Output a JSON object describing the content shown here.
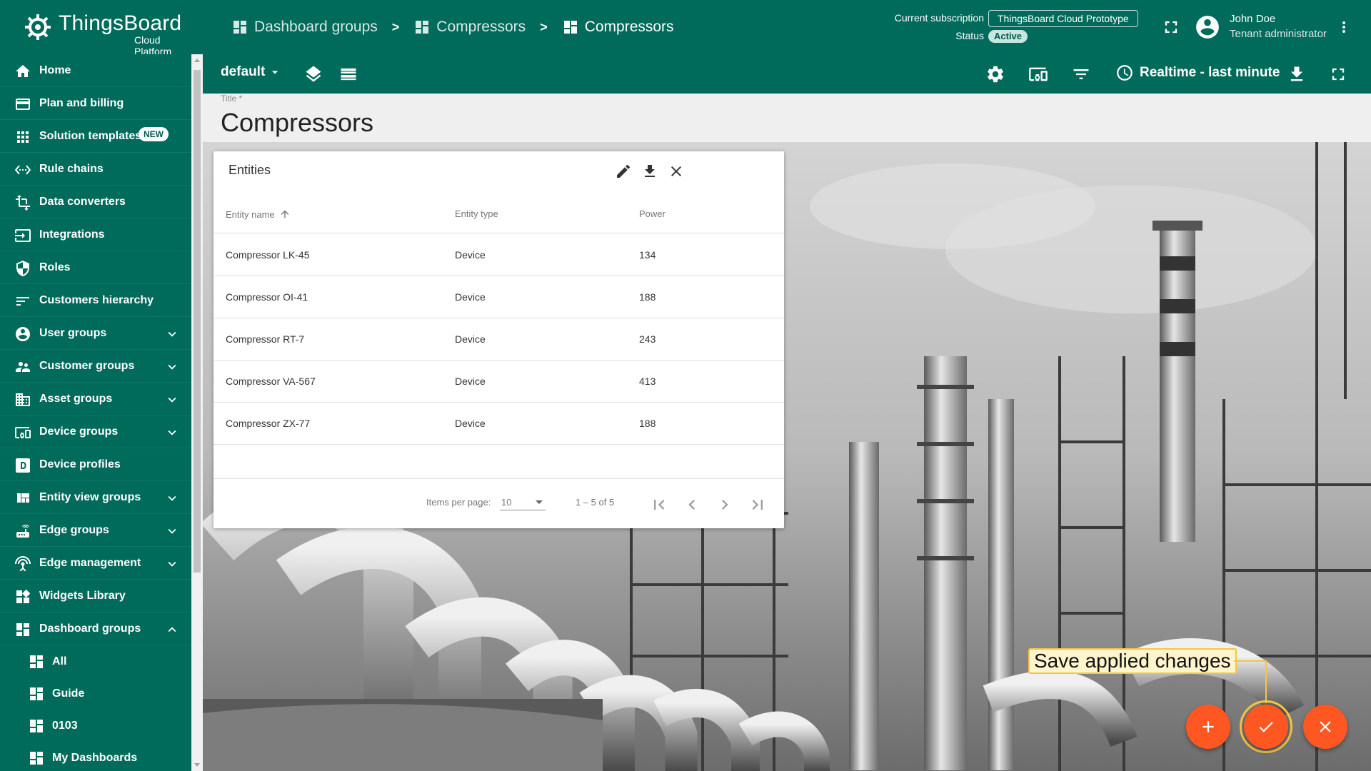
{
  "brand": {
    "name": "ThingsBoard",
    "subtitle": "Cloud Platform"
  },
  "breadcrumbs": [
    {
      "label": "Dashboard groups"
    },
    {
      "label": "Compressors"
    },
    {
      "label": "Compressors"
    }
  ],
  "breadcrumb_separator": ">",
  "subscription": {
    "label": "Current subscription",
    "plan": "ThingsBoard Cloud Prototype",
    "status_label": "Status",
    "status": "Active"
  },
  "user": {
    "name": "John Doe",
    "role": "Tenant administrator"
  },
  "sidebar": {
    "items": [
      {
        "label": "Home",
        "icon": "home-icon"
      },
      {
        "label": "Plan and billing",
        "icon": "credit-card-icon"
      },
      {
        "label": "Solution templates",
        "icon": "apps-grid-icon",
        "badge": "NEW"
      },
      {
        "label": "Rule chains",
        "icon": "settings-ethernet-icon"
      },
      {
        "label": "Data converters",
        "icon": "transform-icon"
      },
      {
        "label": "Integrations",
        "icon": "input-icon"
      },
      {
        "label": "Roles",
        "icon": "security-shield-icon"
      },
      {
        "label": "Customers hierarchy",
        "icon": "sort-lines-icon"
      },
      {
        "label": "User groups",
        "icon": "account-circle-icon",
        "expandable": true
      },
      {
        "label": "Customer groups",
        "icon": "supervisor-account-icon",
        "expandable": true
      },
      {
        "label": "Asset groups",
        "icon": "domain-icon",
        "expandable": true
      },
      {
        "label": "Device groups",
        "icon": "devices-other-icon",
        "expandable": true
      },
      {
        "label": "Device profiles",
        "icon": "device-profile-icon"
      },
      {
        "label": "Entity view groups",
        "icon": "view-quilt-icon",
        "expandable": true
      },
      {
        "label": "Edge groups",
        "icon": "router-icon",
        "expandable": true
      },
      {
        "label": "Edge management",
        "icon": "settings-input-antenna-icon",
        "expandable": true
      },
      {
        "label": "Widgets Library",
        "icon": "widgets-icon"
      },
      {
        "label": "Dashboard groups",
        "icon": "dashboard-icon",
        "expanded": true
      }
    ],
    "sub_items": [
      {
        "label": "All"
      },
      {
        "label": "Guide"
      },
      {
        "label": "0103"
      },
      {
        "label": "My Dashboards"
      }
    ]
  },
  "toolbar": {
    "state": "default",
    "time_window": "Realtime - last minute"
  },
  "dashboard": {
    "title_label": "Title *",
    "title": "Compressors"
  },
  "widget": {
    "title": "Entities",
    "columns": [
      "Entity name",
      "Entity type",
      "Power"
    ],
    "rows": [
      {
        "name": "Compressor LK-45",
        "type": "Device",
        "power": "134"
      },
      {
        "name": "Compressor OI-41",
        "type": "Device",
        "power": "188"
      },
      {
        "name": "Compressor RT-7",
        "type": "Device",
        "power": "243"
      },
      {
        "name": "Compressor VA-567",
        "type": "Device",
        "power": "413"
      },
      {
        "name": "Compressor ZX-77",
        "type": "Device",
        "power": "188"
      }
    ],
    "paginator": {
      "items_per_page_label": "Items per page:",
      "items_per_page": "10",
      "range": "1 – 5 of 5"
    }
  },
  "tooltip": {
    "text": "Save applied changes"
  },
  "colors": {
    "primary": "#006a5b",
    "fab": "#fe5722",
    "highlight": "#f5c542"
  }
}
